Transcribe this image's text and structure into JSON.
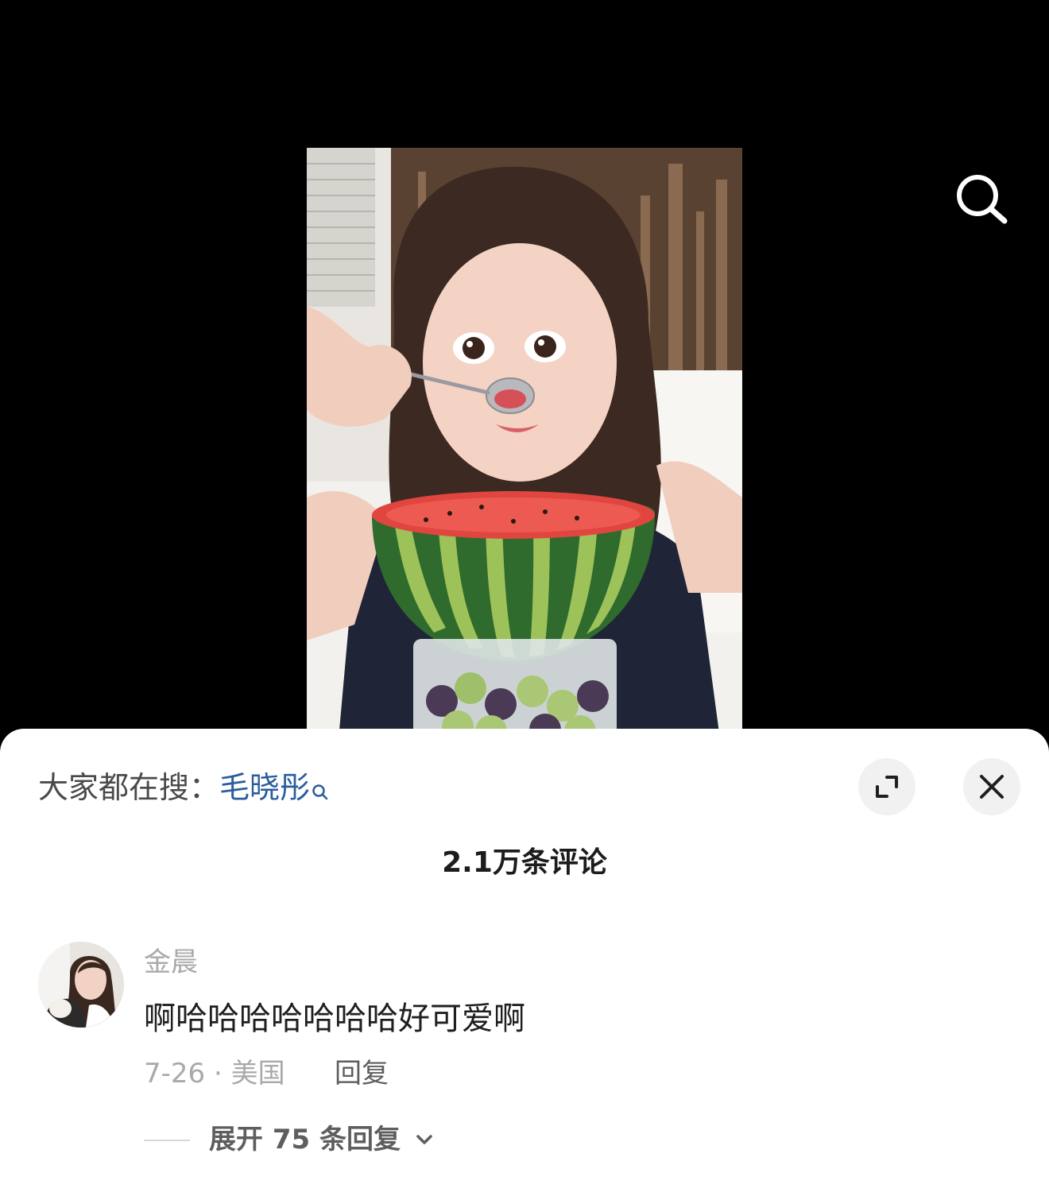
{
  "video": {
    "search_icon": "search-icon"
  },
  "sheet": {
    "trending_prefix": "大家都在搜：",
    "trending_keyword": "毛晓彤",
    "expand_icon": "expand-icon",
    "close_icon": "close-icon",
    "comment_count": "2.1万条评论"
  },
  "comment": {
    "username": "金晨",
    "text": "啊哈哈哈哈哈哈哈好可爱啊",
    "meta": "7-26 · 美国",
    "reply_label": "回复",
    "expand_replies_label": "展开 75 条回复"
  },
  "colors": {
    "keyword": "#2a5d9e",
    "muted": "#a9a9ab",
    "text": "#1f1f1f"
  }
}
